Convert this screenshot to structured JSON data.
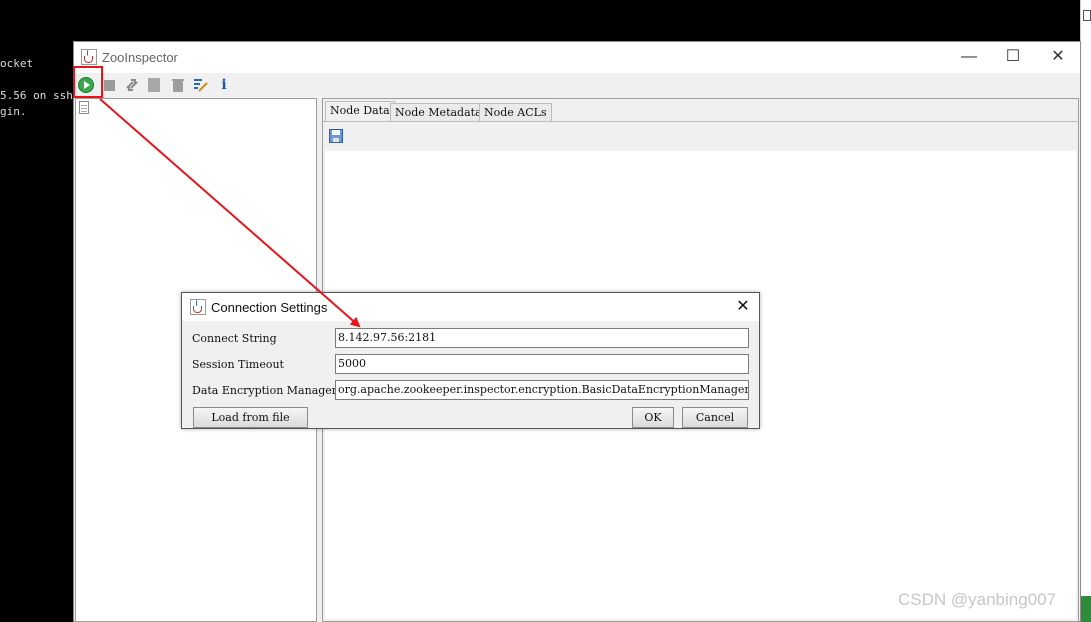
{
  "terminal": {
    "lines": [
      "ocket",
      "5.56 on ssh",
      "gin."
    ]
  },
  "zooinspector": {
    "title": "ZooInspector",
    "window_controls": {
      "minimize": "—",
      "maximize": "☐",
      "close": "✕"
    },
    "toolbar": {
      "icons": [
        "connect-icon",
        "disconnect-icon",
        "refresh-icon",
        "add-node-icon",
        "delete-node-icon",
        "edit-icon",
        "info-icon"
      ],
      "info_label": "i"
    },
    "tabs": [
      {
        "label": "Node Data",
        "active": true
      },
      {
        "label": "Node Metadata",
        "active": false
      },
      {
        "label": "Node ACLs",
        "active": false
      }
    ]
  },
  "connection_dialog": {
    "title": "Connection Settings",
    "close_label": "✕",
    "fields": [
      {
        "label": "Connect String",
        "value": "8.142.97.56:2181"
      },
      {
        "label": "Session Timeout",
        "value": "5000"
      },
      {
        "label": "Data Encryption Manager",
        "value": "org.apache.zookeeper.inspector.encryption.BasicDataEncryptionManager"
      }
    ],
    "buttons": {
      "load": "Load from file",
      "ok": "OK",
      "cancel": "Cancel"
    }
  },
  "annotation": {
    "color": "#e8141a"
  },
  "watermark": "CSDN @yanbing007"
}
